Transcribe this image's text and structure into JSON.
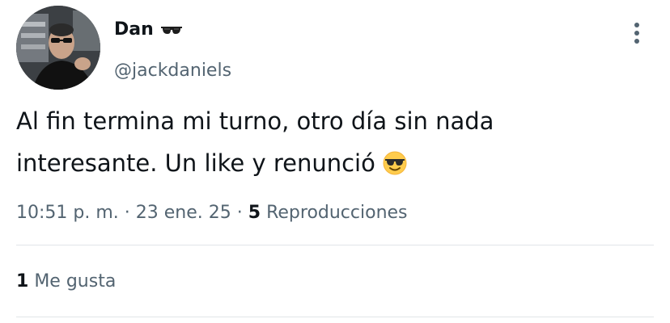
{
  "author": {
    "display_name": "Dan",
    "name_emoji_icon": "sunglasses-icon",
    "handle": "@jackdaniels",
    "avatar_icon": "avatar-photo"
  },
  "tweet": {
    "text_line1": "Al fin termina mi turno, otro día sin nada",
    "text_line2": "interesante. Un like y renunció",
    "text_emoji_icon": "smiling-face-with-sunglasses-icon"
  },
  "meta": {
    "time": "10:51 p. m.",
    "separator1": "·",
    "date": "23 ene. 25",
    "separator2": "·",
    "views_count": "5",
    "views_label": "Reproducciones"
  },
  "engagement": {
    "likes_count": "1",
    "likes_label": "Me gusta"
  },
  "menu": {
    "icon": "more-options-icon"
  },
  "colors": {
    "text_primary": "#0f1419",
    "text_secondary": "#536471",
    "divider": "#e1e5e8"
  }
}
